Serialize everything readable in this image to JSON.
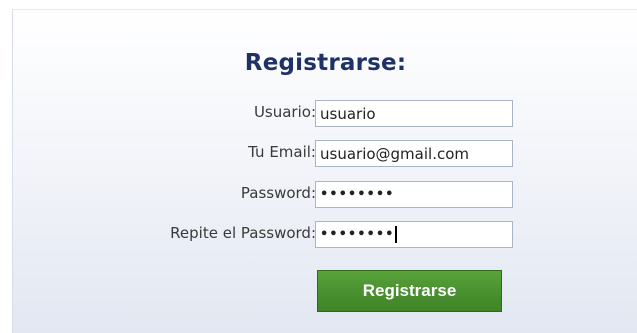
{
  "form": {
    "title": "Registrarse:",
    "fields": [
      {
        "label": "Usuario:",
        "value": "usuario",
        "type": "text"
      },
      {
        "label": "Tu Email:",
        "value": "usuario@gmail.com",
        "type": "text"
      },
      {
        "label": "Password:",
        "value": "••••••••",
        "type": "password"
      },
      {
        "label": "Repite el Password:",
        "value": "••••••••",
        "type": "password"
      }
    ],
    "submit_label": "Registrarse"
  },
  "colors": {
    "title": "#1f3266",
    "button": "#4a9130"
  }
}
